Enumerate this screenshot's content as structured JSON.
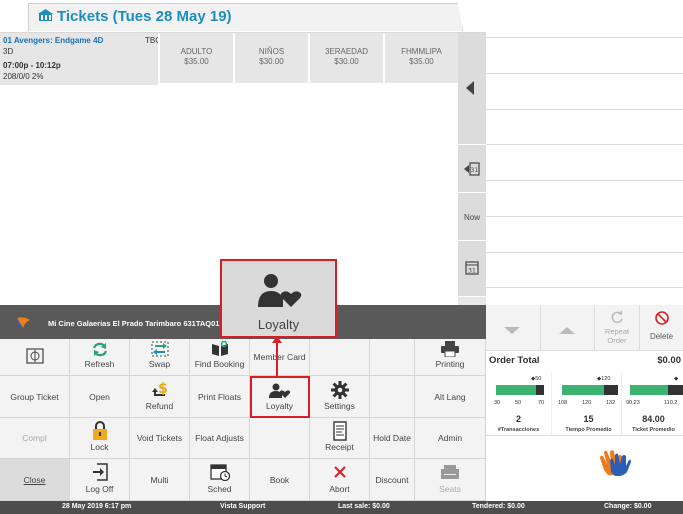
{
  "header": {
    "title": "Tickets (Tues 28 May 19)",
    "icon": "cinema-icon"
  },
  "session": {
    "line1": "01  Avengers: Endgame 4D",
    "tbc": "TBC",
    "line2": "3D",
    "line3": "07:00p - 10:12p",
    "line4": "208/0/0  2%"
  },
  "prices": [
    {
      "name": "ADULTO",
      "price": "$35.00"
    },
    {
      "name": "NIÑOS",
      "price": "$30.00"
    },
    {
      "name": "3ERAEDAD",
      "price": "$30.00"
    },
    {
      "name": "FHMMLIPA",
      "price": "$35.00"
    }
  ],
  "side": {
    "now": "Now"
  },
  "status": {
    "text": "Mi Cine Galaerias El Prado Tarimbaro  631TAQ01  5"
  },
  "popup": {
    "label": "Loyalty"
  },
  "grid": {
    "refresh": "Refresh",
    "swap": "Swap",
    "find_booking": "Find Booking",
    "member_card": "Member Card",
    "printing": "Printing",
    "group_ticket": "Group Ticket",
    "open": "Open",
    "refund": "Refund",
    "print_floats": "Print Floats",
    "loyalty": "Loyalty",
    "settings": "Settings",
    "alt_lang": "Alt Lang",
    "compl": "Compl",
    "lock": "Lock",
    "void_tickets": "Void Tickets",
    "float_adjusts": "Float Adjusts",
    "receipt": "Receipt",
    "hold_date": "Hold Date",
    "admin": "Admin",
    "close": "Close",
    "log_off": "Log Off",
    "multi": "Multi",
    "sched": "Sched",
    "book": "Book",
    "abort": "Abort",
    "discount": "Discount",
    "seats": "Seats"
  },
  "right": {
    "repeat_order": "Repeat Order",
    "delete": "Delete",
    "order_total": "Order Total",
    "order_total_value": "$0.00",
    "kpis": [
      {
        "target": "50",
        "ticks": [
          "30",
          "50",
          "70"
        ],
        "value": "2",
        "label": "#Transacciones"
      },
      {
        "target": "120",
        "ticks": [
          "108",
          "120",
          "132"
        ],
        "value": "15",
        "label": "Tiempo Promedio"
      },
      {
        "target": "",
        "ticks": [
          "90.23",
          "110.2"
        ],
        "value": "84.00",
        "label": "Ticket Promedio"
      }
    ]
  },
  "footer": {
    "datetime": "28 May 2019 6:17 pm",
    "support": "Vista Support",
    "last_sale": "Last sale: $0.00",
    "tendered": "Tendered: $0.00",
    "change": "Change: $0.00"
  }
}
